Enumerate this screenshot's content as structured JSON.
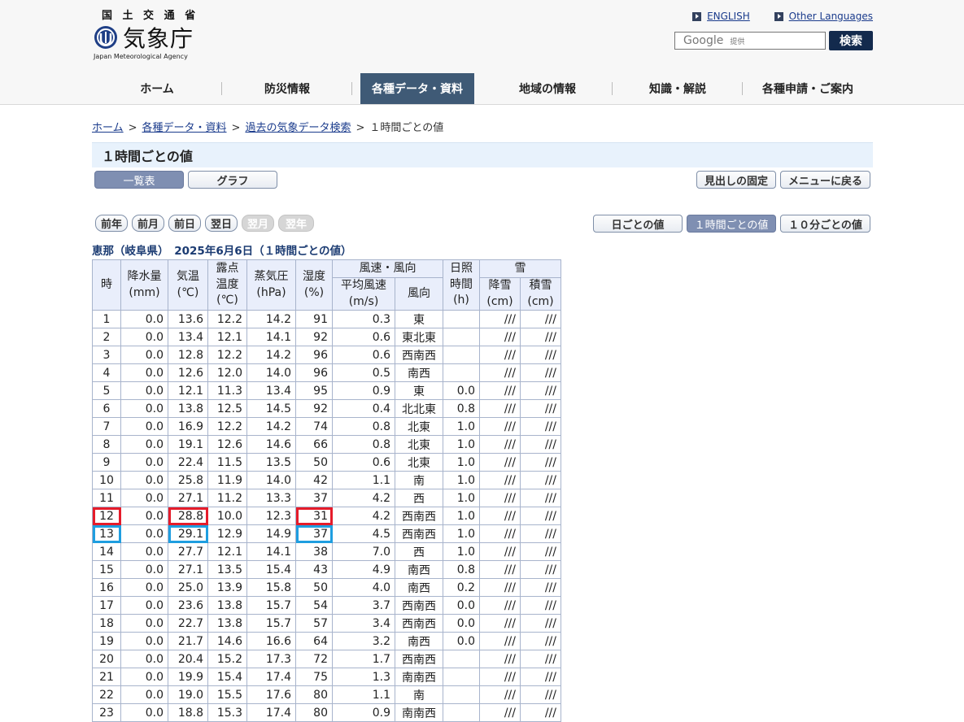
{
  "header": {
    "logo_kanji": "国 土 交 通 省",
    "logo_name": "気象庁",
    "logo_en": "Japan Meteorological Agency",
    "links": [
      "ENGLISH",
      "Other Languages"
    ],
    "search_brand": "Google",
    "search_provided": "提供",
    "search_button": "検索"
  },
  "nav": {
    "items": [
      "ホーム",
      "防災情報",
      "各種データ・資料",
      "地域の情報",
      "知識・解説",
      "各種申請・ご案内"
    ],
    "active_index": 2,
    "active_color": "#3f5a76"
  },
  "breadcrumb": {
    "items": [
      "ホーム",
      "各種データ・資料",
      "過去の気象データ検索",
      "１時間ごとの値"
    ],
    "separator": ">"
  },
  "page_title": "１時間ごとの値",
  "view_tabs": {
    "list": "一覧表",
    "graph": "グラフ"
  },
  "top_right_buttons": {
    "fix_header": "見出しの固定",
    "back_menu": "メニューに戻る"
  },
  "date_nav": {
    "prev_year": "前年",
    "prev_month": "前月",
    "prev_day": "前日",
    "next_day": "翌日",
    "next_month": "翌月",
    "next_year": "翌年"
  },
  "interval_tabs": {
    "daily": "日ごとの値",
    "hourly": "１時間ごとの値",
    "ten_min": "１０分ごとの値"
  },
  "caption": "恵那（岐阜県）　2025年6月6日（１時間ごとの値）",
  "table": {
    "headers": {
      "hour": "時",
      "precip": "降水量",
      "precip_unit": "(mm)",
      "temp": "気温",
      "temp_unit": "(℃)",
      "dew_1": "露点",
      "dew_2": "温度",
      "dew_unit": "(℃)",
      "vapor": "蒸気圧",
      "vapor_unit": "(hPa)",
      "humid": "湿度",
      "humid_unit": "(%)",
      "wind_group": "風速・風向",
      "wind_speed": "平均風速",
      "wind_speed_unit": "(m/s)",
      "wind_dir": "風向",
      "sun_1": "日照",
      "sun_2": "時間",
      "sun_unit": "(h)",
      "snow_group": "雪",
      "snowfall": "降雪",
      "snowfall_unit": "(cm)",
      "snowdepth": "積雪",
      "snowdepth_unit": "(cm)"
    },
    "rows": [
      {
        "hour": "1",
        "precip": "0.0",
        "temp": "13.6",
        "dew": "12.2",
        "vapor": "14.2",
        "humid": "91",
        "wind": "0.3",
        "dir": "東",
        "sun": "",
        "snowfall": "///",
        "snowdepth": "///"
      },
      {
        "hour": "2",
        "precip": "0.0",
        "temp": "13.4",
        "dew": "12.1",
        "vapor": "14.1",
        "humid": "92",
        "wind": "0.6",
        "dir": "東北東",
        "sun": "",
        "snowfall": "///",
        "snowdepth": "///"
      },
      {
        "hour": "3",
        "precip": "0.0",
        "temp": "12.8",
        "dew": "12.2",
        "vapor": "14.2",
        "humid": "96",
        "wind": "0.6",
        "dir": "西南西",
        "sun": "",
        "snowfall": "///",
        "snowdepth": "///"
      },
      {
        "hour": "4",
        "precip": "0.0",
        "temp": "12.6",
        "dew": "12.0",
        "vapor": "14.0",
        "humid": "96",
        "wind": "0.5",
        "dir": "南西",
        "sun": "",
        "snowfall": "///",
        "snowdepth": "///"
      },
      {
        "hour": "5",
        "precip": "0.0",
        "temp": "12.1",
        "dew": "11.3",
        "vapor": "13.4",
        "humid": "95",
        "wind": "0.9",
        "dir": "東",
        "sun": "0.0",
        "snowfall": "///",
        "snowdepth": "///"
      },
      {
        "hour": "6",
        "precip": "0.0",
        "temp": "13.8",
        "dew": "12.5",
        "vapor": "14.5",
        "humid": "92",
        "wind": "0.4",
        "dir": "北北東",
        "sun": "0.8",
        "snowfall": "///",
        "snowdepth": "///"
      },
      {
        "hour": "7",
        "precip": "0.0",
        "temp": "16.9",
        "dew": "12.2",
        "vapor": "14.2",
        "humid": "74",
        "wind": "0.8",
        "dir": "北東",
        "sun": "1.0",
        "snowfall": "///",
        "snowdepth": "///"
      },
      {
        "hour": "8",
        "precip": "0.0",
        "temp": "19.1",
        "dew": "12.6",
        "vapor": "14.6",
        "humid": "66",
        "wind": "0.8",
        "dir": "北東",
        "sun": "1.0",
        "snowfall": "///",
        "snowdepth": "///"
      },
      {
        "hour": "9",
        "precip": "0.0",
        "temp": "22.4",
        "dew": "11.5",
        "vapor": "13.5",
        "humid": "50",
        "wind": "0.6",
        "dir": "北東",
        "sun": "1.0",
        "snowfall": "///",
        "snowdepth": "///"
      },
      {
        "hour": "10",
        "precip": "0.0",
        "temp": "25.8",
        "dew": "11.9",
        "vapor": "14.0",
        "humid": "42",
        "wind": "1.1",
        "dir": "南",
        "sun": "1.0",
        "snowfall": "///",
        "snowdepth": "///"
      },
      {
        "hour": "11",
        "precip": "0.0",
        "temp": "27.1",
        "dew": "11.2",
        "vapor": "13.3",
        "humid": "37",
        "wind": "4.2",
        "dir": "西",
        "sun": "1.0",
        "snowfall": "///",
        "snowdepth": "///"
      },
      {
        "hour": "12",
        "precip": "0.0",
        "temp": "28.8",
        "dew": "10.0",
        "vapor": "12.3",
        "humid": "31",
        "wind": "4.2",
        "dir": "西南西",
        "sun": "1.0",
        "snowfall": "///",
        "snowdepth": "///"
      },
      {
        "hour": "13",
        "precip": "0.0",
        "temp": "29.1",
        "dew": "12.9",
        "vapor": "14.9",
        "humid": "37",
        "wind": "4.5",
        "dir": "西南西",
        "sun": "1.0",
        "snowfall": "///",
        "snowdepth": "///"
      },
      {
        "hour": "14",
        "precip": "0.0",
        "temp": "27.7",
        "dew": "12.1",
        "vapor": "14.1",
        "humid": "38",
        "wind": "7.0",
        "dir": "西",
        "sun": "1.0",
        "snowfall": "///",
        "snowdepth": "///"
      },
      {
        "hour": "15",
        "precip": "0.0",
        "temp": "27.1",
        "dew": "13.5",
        "vapor": "15.4",
        "humid": "43",
        "wind": "4.9",
        "dir": "南西",
        "sun": "0.8",
        "snowfall": "///",
        "snowdepth": "///"
      },
      {
        "hour": "16",
        "precip": "0.0",
        "temp": "25.0",
        "dew": "13.9",
        "vapor": "15.8",
        "humid": "50",
        "wind": "4.0",
        "dir": "南西",
        "sun": "0.2",
        "snowfall": "///",
        "snowdepth": "///"
      },
      {
        "hour": "17",
        "precip": "0.0",
        "temp": "23.6",
        "dew": "13.8",
        "vapor": "15.7",
        "humid": "54",
        "wind": "3.7",
        "dir": "西南西",
        "sun": "0.0",
        "snowfall": "///",
        "snowdepth": "///"
      },
      {
        "hour": "18",
        "precip": "0.0",
        "temp": "22.7",
        "dew": "13.8",
        "vapor": "15.7",
        "humid": "57",
        "wind": "3.4",
        "dir": "西南西",
        "sun": "0.0",
        "snowfall": "///",
        "snowdepth": "///"
      },
      {
        "hour": "19",
        "precip": "0.0",
        "temp": "21.7",
        "dew": "14.6",
        "vapor": "16.6",
        "humid": "64",
        "wind": "3.2",
        "dir": "南西",
        "sun": "0.0",
        "snowfall": "///",
        "snowdepth": "///"
      },
      {
        "hour": "20",
        "precip": "0.0",
        "temp": "20.4",
        "dew": "15.2",
        "vapor": "17.3",
        "humid": "72",
        "wind": "1.7",
        "dir": "西南西",
        "sun": "",
        "snowfall": "///",
        "snowdepth": "///"
      },
      {
        "hour": "21",
        "precip": "0.0",
        "temp": "19.9",
        "dew": "15.4",
        "vapor": "17.4",
        "humid": "75",
        "wind": "1.3",
        "dir": "南南西",
        "sun": "",
        "snowfall": "///",
        "snowdepth": "///"
      },
      {
        "hour": "22",
        "precip": "0.0",
        "temp": "19.0",
        "dew": "15.5",
        "vapor": "17.6",
        "humid": "80",
        "wind": "1.1",
        "dir": "南",
        "sun": "",
        "snowfall": "///",
        "snowdepth": "///"
      },
      {
        "hour": "23",
        "precip": "0.0",
        "temp": "18.8",
        "dew": "15.3",
        "vapor": "17.4",
        "humid": "80",
        "wind": "0.9",
        "dir": "南南西",
        "sun": "",
        "snowfall": "///",
        "snowdepth": "///"
      }
    ],
    "highlight_red_hour": "12",
    "highlight_blue_hour": "13",
    "highlight_columns": [
      "hour",
      "temp",
      "humid"
    ],
    "highlight_red_color": "#e51c2a",
    "highlight_blue_color": "#1f9ee0"
  }
}
